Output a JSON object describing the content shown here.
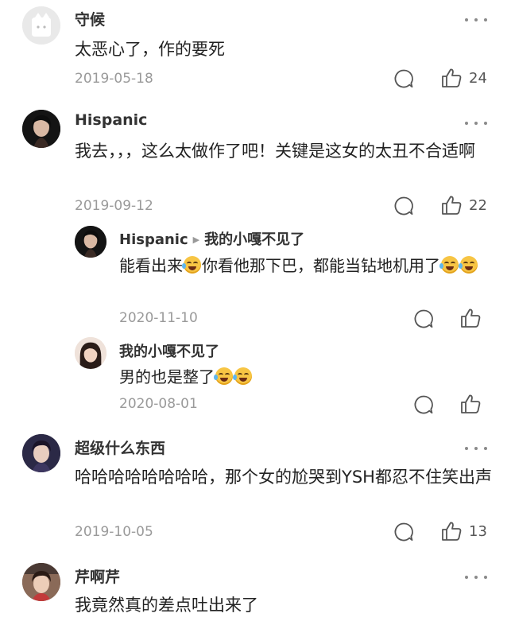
{
  "comments": [
    {
      "user": "守候",
      "text": "太恶心了，作的要死",
      "date": "2019-05-18",
      "likes": "24"
    },
    {
      "user": "Hispanic",
      "text": "我去，，，这么太做作了吧！关键是这女的太丑不合适啊",
      "date": "2019-09-12",
      "likes": "22",
      "replies": [
        {
          "user": "Hispanic",
          "reply_to": "我的小嘎不见了",
          "text_a": "能看出来",
          "text_b": "你看他那下巴，都能当钻地机用了",
          "date": "2020-11-10"
        },
        {
          "user": "我的小嘎不见了",
          "text": "男的也是整了",
          "date": "2020-08-01"
        }
      ]
    },
    {
      "user": "超级什么东西",
      "text": "哈哈哈哈哈哈哈哈，那个女的尬哭到YSH都忍不住笑出声",
      "date": "2019-10-05",
      "likes": "13"
    },
    {
      "user": "芹啊芹",
      "text": "我竟然真的差点吐出来了"
    }
  ],
  "icons": {
    "reply": "reply-bubble-icon",
    "like": "thumbs-up-icon",
    "more": "more-dots-icon",
    "emoji": "laughing-tears-emoji"
  }
}
